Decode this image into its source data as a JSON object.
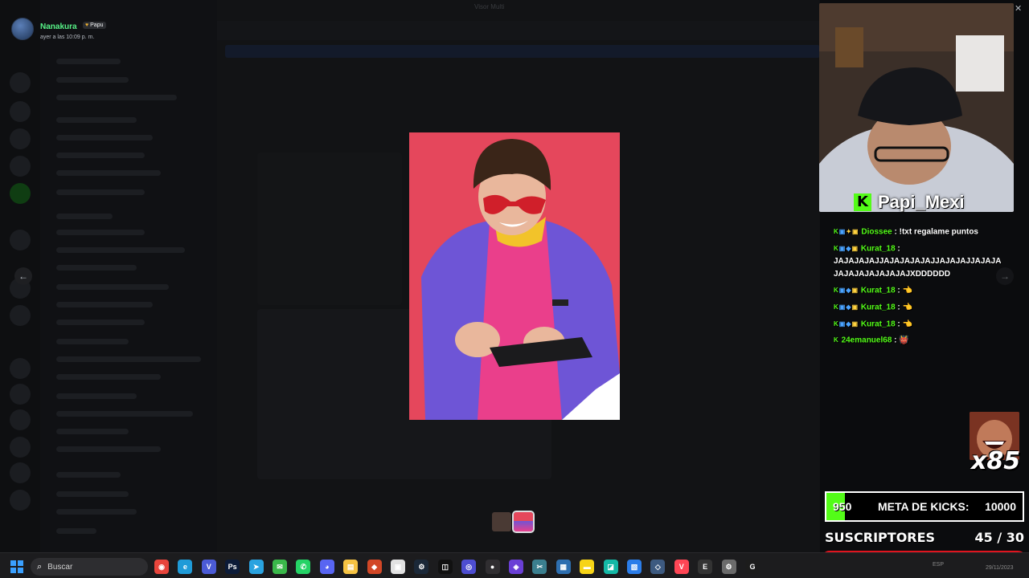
{
  "window": {
    "title": "Visor Multi"
  },
  "viewer": {
    "user_name": "Nanakura",
    "badge_label": "Papu",
    "timestamp": "ayer a las 10:09 p. m."
  },
  "icons": {
    "prev": "arrow-left-icon",
    "next": "arrow-right-icon",
    "close": "close-icon",
    "search": "search-icon"
  },
  "stream": {
    "streamer_name": "Papi_Mexi",
    "kick_glyph": "K",
    "chat": [
      {
        "user": "Diossee",
        "text": "!txt regalame puntos",
        "badges": "K▣✦▣"
      },
      {
        "user": "Kurat_18",
        "text": "JAJAJAJAJJAJAJAJAJAJJAJAJAJJAJAJAJAJAJAJAJAJAJAJXDDDDDD",
        "badges": "K▣◆▣"
      },
      {
        "user": "Kurat_18",
        "text": "👈",
        "badges": "K▣◆▣"
      },
      {
        "user": "Kurat_18",
        "text": "👈",
        "badges": "K▣◆▣"
      },
      {
        "user": "Kurat_18",
        "text": "👈",
        "badges": "K▣◆▣"
      },
      {
        "user": "24emanuel68",
        "text": "👹",
        "badges": "K"
      }
    ],
    "combo": "x85",
    "kick_goal": {
      "current": "950",
      "label": "META DE KICKS:",
      "target": "10000",
      "progress": 0.095
    },
    "subs": {
      "label": "SUSCRIPTORES",
      "count": "45 / 30",
      "progress": 1.0
    },
    "colors": {
      "kick_green": "#53fc18",
      "subs_border": "#e0141e"
    }
  },
  "taskbar": {
    "search_placeholder": "Buscar",
    "apps": [
      "chrome",
      "edge",
      "vivaldi",
      "photoshop",
      "telegram",
      "messages",
      "whatsapp",
      "discord",
      "explorer",
      "office",
      "roblox",
      "steam",
      "capcut",
      "ubisoft",
      "obs",
      "launcher",
      "snip",
      "notes",
      "terminal",
      "vscode",
      "files",
      "tools",
      "valorant",
      "epic",
      "settings",
      "logitech"
    ],
    "tray_lang": "ESP",
    "date": "29/11/2023"
  }
}
